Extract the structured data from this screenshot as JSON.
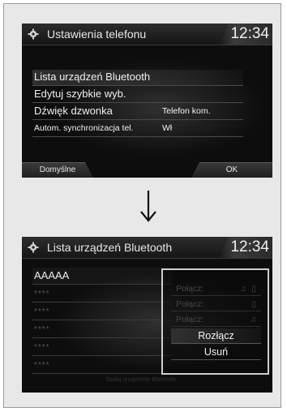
{
  "screen1": {
    "title": "Ustawienia telefonu",
    "clock": "12:34",
    "menu": [
      {
        "label": "Lista urządzeń Bluetooth",
        "value": ""
      },
      {
        "label": "Edytuj szybkie wyb.",
        "value": ""
      },
      {
        "label": "Dźwięk dzwonka",
        "value": "Telefon kom."
      },
      {
        "label": "Autom. synchronizacja tel.",
        "value": "Wł"
      }
    ],
    "softkeys": {
      "left": "Domyślne",
      "right": "OK"
    }
  },
  "arrow_icon": "down-arrow",
  "screen2": {
    "title": "Lista urządzeń Bluetooth",
    "clock": "12:34",
    "devices": [
      "AAAAA",
      "****",
      "****",
      "****",
      "****",
      "****"
    ],
    "popup": {
      "dim_items": [
        {
          "label": "Połącz:",
          "icons": [
            "music-note-icon",
            "phone-icon"
          ]
        },
        {
          "label": "Połącz:",
          "icons": [
            "phone-icon"
          ]
        },
        {
          "label": "Połącz:",
          "icons": [
            "music-note-icon"
          ]
        }
      ],
      "disconnect": "Rozłącz",
      "delete": "Usuń"
    },
    "footer_hint": "Dodaj urządzenie Bluetooth"
  }
}
